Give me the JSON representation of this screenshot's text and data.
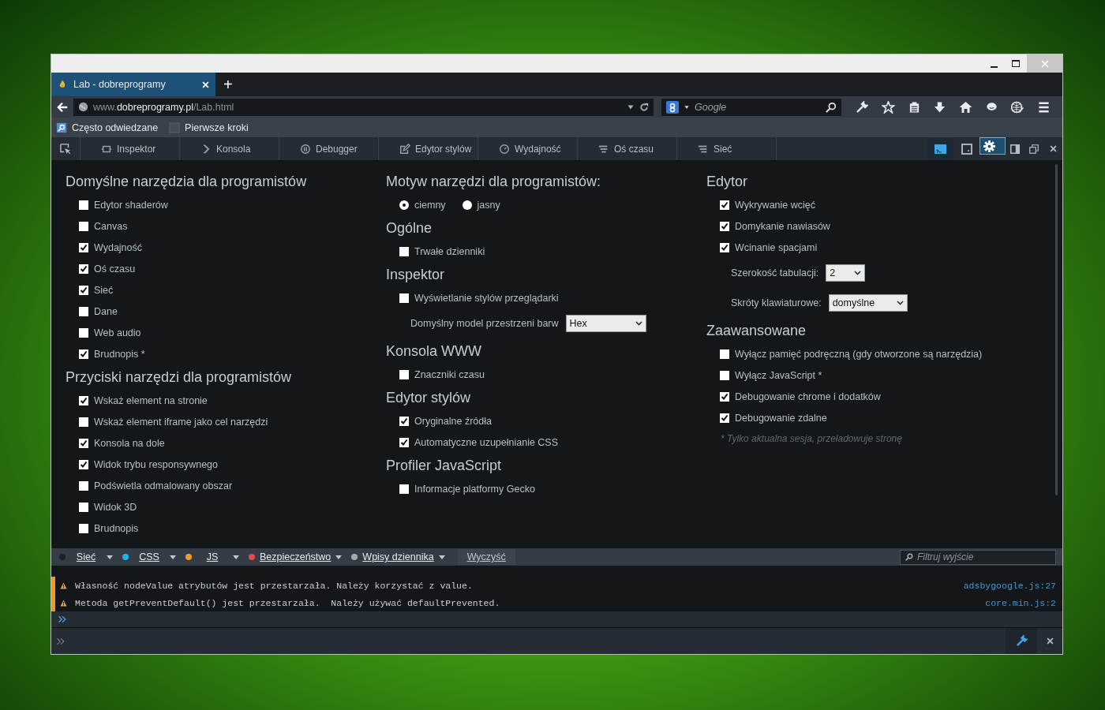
{
  "tabs": [
    {
      "title": "Lab - dobreprogramy",
      "selected": true
    }
  ],
  "new_tab": "+",
  "url": {
    "prefix": "www.",
    "host": "dobreprogramy.pl",
    "path": "/Lab.html"
  },
  "search": {
    "placeholder": "Google"
  },
  "bookmarks": [
    "Często odwiedzane",
    "Pierwsze kroki"
  ],
  "devtools": {
    "tabs": [
      {
        "label": "Inspektor",
        "selected": false
      },
      {
        "label": "Konsola",
        "selected": false
      },
      {
        "label": "Debugger",
        "selected": false
      },
      {
        "label": "Edytor stylów",
        "selected": false
      },
      {
        "label": "Wydajność",
        "selected": false
      },
      {
        "label": "Oś czasu",
        "selected": false
      },
      {
        "label": "Sieć",
        "selected": false
      }
    ],
    "command_buttons": [
      {
        "on": true
      },
      {
        "on": false
      }
    ],
    "options_selected": true
  },
  "options": {
    "columns": [
      {
        "sections": [
          {
            "heading": "Domyślne narzędzia dla programistów",
            "items": [
              {
                "kind": "checkbox",
                "label": "Edytor shaderów",
                "checked": false
              },
              {
                "kind": "checkbox",
                "label": "Canvas",
                "checked": false
              },
              {
                "kind": "checkbox",
                "label": "Wydajność",
                "checked": true
              },
              {
                "kind": "checkbox",
                "label": "Oś czasu",
                "checked": true
              },
              {
                "kind": "checkbox",
                "label": "Sieć",
                "checked": true
              },
              {
                "kind": "checkbox",
                "label": "Dane",
                "checked": false
              },
              {
                "kind": "checkbox",
                "label": "Web audio",
                "checked": false
              },
              {
                "kind": "checkbox",
                "label": "Brudnopis *",
                "checked": true
              }
            ]
          },
          {
            "heading": "Przyciski narzędzi dla programistów",
            "items": [
              {
                "kind": "checkbox",
                "label": "Wskaż element na stronie",
                "checked": true
              },
              {
                "kind": "checkbox",
                "label": "Wskaż element iframe jako cel narzędzi",
                "checked": false
              },
              {
                "kind": "checkbox",
                "label": "Konsola na dole",
                "checked": true
              },
              {
                "kind": "checkbox",
                "label": "Widok trybu responsywnego",
                "checked": true
              },
              {
                "kind": "checkbox",
                "label": "Podświetla odmalowany obszar",
                "checked": false
              },
              {
                "kind": "checkbox",
                "label": "Widok 3D",
                "checked": false
              },
              {
                "kind": "checkbox",
                "label": "Brudnopis",
                "checked": false
              }
            ]
          }
        ]
      },
      {
        "sections": [
          {
            "heading": "Motyw narzędzi dla programistów:",
            "items": [
              {
                "kind": "radios",
                "options": [
                  {
                    "label": "ciemny",
                    "selected": true
                  },
                  {
                    "label": "jasny",
                    "selected": false
                  }
                ]
              }
            ]
          },
          {
            "heading": "Ogólne",
            "items": [
              {
                "kind": "checkbox",
                "label": "Trwałe dzienniki",
                "checked": false
              }
            ]
          },
          {
            "heading": "Inspektor",
            "items": [
              {
                "kind": "checkbox",
                "label": "Wyświetlanie stylów przeglądarki",
                "checked": false
              },
              {
                "kind": "select",
                "label": "Domyślny model przestrzeni barw",
                "value": "Hex"
              }
            ]
          },
          {
            "heading": "Konsola WWW",
            "items": [
              {
                "kind": "checkbox",
                "label": "Znaczniki czasu",
                "checked": false
              }
            ]
          },
          {
            "heading": "Edytor stylów",
            "items": [
              {
                "kind": "checkbox",
                "label": "Oryginalne źródła",
                "checked": true
              },
              {
                "kind": "checkbox",
                "label": "Automatyczne uzupełnianie CSS",
                "checked": true
              }
            ]
          },
          {
            "heading": "Profiler JavaScript",
            "items": [
              {
                "kind": "checkbox",
                "label": "Informacje platformy Gecko",
                "checked": false
              }
            ]
          }
        ]
      },
      {
        "sections": [
          {
            "heading": "Edytor",
            "items": [
              {
                "kind": "checkbox",
                "label": "Wykrywanie wcięć",
                "checked": true
              },
              {
                "kind": "checkbox",
                "label": "Domykanie nawiasów",
                "checked": true
              },
              {
                "kind": "checkbox",
                "label": "Wcinanie spacjami",
                "checked": true
              },
              {
                "kind": "select",
                "label": "Szerokość tabulacji:",
                "value": "2"
              },
              {
                "kind": "select",
                "label": "Skróty klawiaturowe:",
                "value": "domyślne"
              }
            ]
          },
          {
            "heading": "Zaawansowane",
            "items": [
              {
                "kind": "checkbox",
                "label": "Wyłącz pamięć podręczną (gdy otworzone są narzędzia)",
                "checked": false
              },
              {
                "kind": "checkbox",
                "label": "Wyłącz JavaScript *",
                "checked": false
              },
              {
                "kind": "checkbox",
                "label": "Debugowanie chrome i dodatków",
                "checked": true
              },
              {
                "kind": "checkbox",
                "label": "Debugowanie zdalne",
                "checked": true
              },
              {
                "kind": "note",
                "label": "* Tylko aktualna sesja, przeładowuje stronę"
              }
            ]
          }
        ]
      }
    ]
  },
  "console": {
    "filters": [
      {
        "label": "Sieć",
        "color": "#202020"
      },
      {
        "label": "CSS",
        "color": "#1eb4ef"
      },
      {
        "label": "JS",
        "color": "#f29b2a"
      },
      {
        "label": "Bezpieczeństwo",
        "color": "#e84848"
      },
      {
        "label": "Wpisy dziennika",
        "color": "#a8a8a8"
      }
    ],
    "clear": "Wyczyść",
    "filter_placeholder": "Filtruj wyjście",
    "messages": [
      {
        "kind": "warning",
        "text": "Własność nodeValue atrybutów jest przestarzała. Należy korzystać z value.",
        "source": "adsbygoogle.js:27"
      },
      {
        "kind": "warning",
        "text": "Metoda getPreventDefault() jest przestarzała.  Należy używać defaultPrevented.",
        "source": "core.min.js:2"
      }
    ]
  }
}
